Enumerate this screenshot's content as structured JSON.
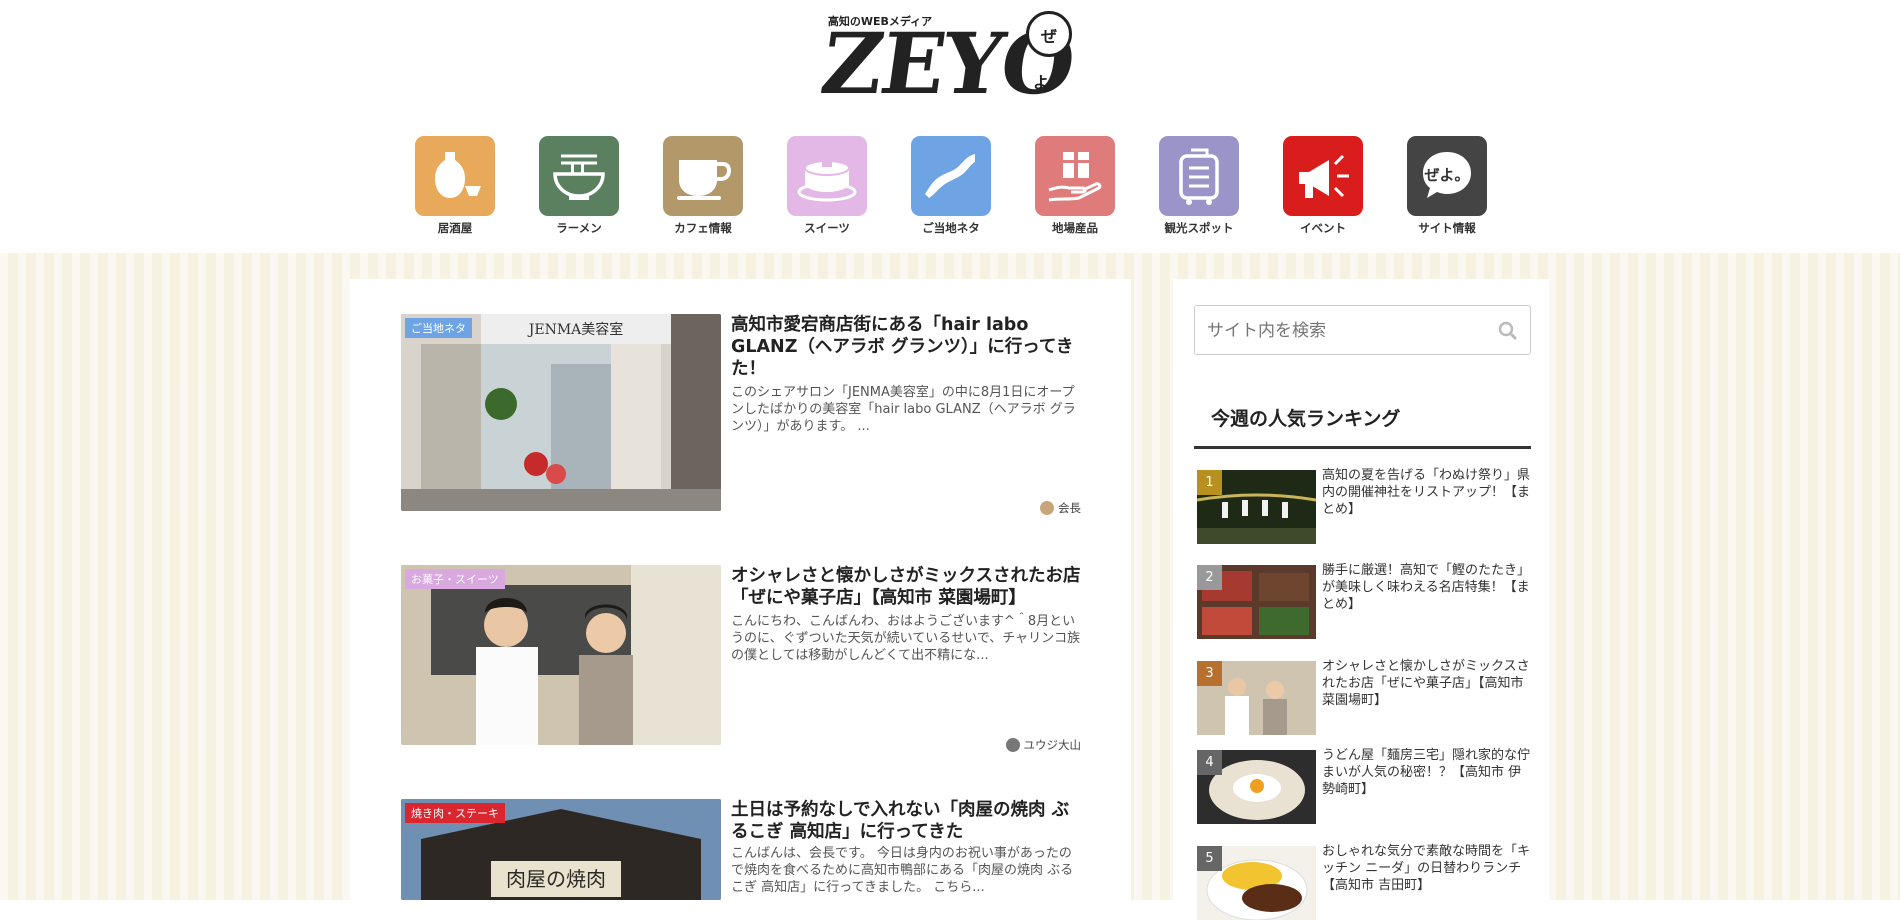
{
  "header": {
    "tagline": "高知のWEBメディア",
    "logo_text": "ZEYO",
    "logo_badge": "ぜよ。"
  },
  "nav": [
    {
      "label": "居酒屋",
      "icon": "sake-bottle-icon",
      "color": "#e8a95a"
    },
    {
      "label": "ラーメン",
      "icon": "ramen-bowl-icon",
      "color": "#5a8060"
    },
    {
      "label": "カフェ情報",
      "icon": "coffee-cup-icon",
      "color": "#b39869"
    },
    {
      "label": "スイーツ",
      "icon": "pancake-icon",
      "color": "#e3b8e6"
    },
    {
      "label": "ご当地ネタ",
      "icon": "kochi-map-icon",
      "color": "#6ea4e3"
    },
    {
      "label": "地場産品",
      "icon": "gift-hand-icon",
      "color": "#e07b7b"
    },
    {
      "label": "観光スポット",
      "icon": "suitcase-icon",
      "color": "#9a94c9"
    },
    {
      "label": "イベント",
      "icon": "megaphone-icon",
      "color": "#d91c1c"
    },
    {
      "label": "サイト情報",
      "icon": "zeyo-speech-icon",
      "color": "#444444"
    }
  ],
  "articles": [
    {
      "category": "ご当地ネタ",
      "category_color": "#6ea4e3",
      "title": "高知市愛宕商店街にある「hair labo GLANZ（ヘアラボ グランツ）」に行ってきた！",
      "excerpt": "このシェアサロン「JENMA美容室」の中に8月1日にオープンしたばかりの美容室「hair labo GLANZ（ヘアラボ グランツ）」があります。 ...",
      "author": "会長",
      "thumb_sign": "JENMA美容室"
    },
    {
      "category": "お菓子・スイーツ",
      "category_color": "#d9a8df",
      "title": "オシャレさと懐かしさがミックスされたお店「ぜにや菓子店」【高知市 菜園場町】",
      "excerpt": "こんにちわ、こんばんわ、おはようございます^＾8月というのに、ぐずついた天気が続いているせいで、チャリンコ族の僕としては移動がしんどくて出不精にな...",
      "author": "ユウジ大山"
    },
    {
      "category": "焼き肉・ステーキ",
      "category_color": "#d9262f",
      "title": "土日は予約なしで入れない「肉屋の焼肉 ぶるこぎ 高知店」に行ってきた",
      "excerpt": "こんばんは、会長です。 今日は身内のお祝い事があったので焼肉を食べるために高知市鴨部にある「肉屋の焼肉 ぶるこぎ 高知店」に行ってきました。 こちら...",
      "author": "",
      "thumb_sign": "肉屋の焼肉"
    }
  ],
  "search": {
    "placeholder": "サイト内を検索"
  },
  "ranking": {
    "title": "今週の人気ランキング",
    "items": [
      {
        "num": "1",
        "badge_color": "#b8901f",
        "title": "高知の夏を告げる「わぬけ祭り」県内の開催神社をリストアップ！【まとめ】"
      },
      {
        "num": "2",
        "badge_color": "#999999",
        "title": "勝手に厳選！高知で「鰹のたたき」が美味しく味わえる名店特集！【まとめ】"
      },
      {
        "num": "3",
        "badge_color": "#b8702f",
        "title": "オシャレさと懐かしさがミックスされたお店「ぜにや菓子店」【高知市 菜園場町】"
      },
      {
        "num": "4",
        "badge_color": "#666666",
        "title": "うどん屋「麺房三宅」隠れ家的な佇まいが人気の秘密！？【高知市 伊勢崎町】"
      },
      {
        "num": "5",
        "badge_color": "#666666",
        "title": "おしゃれな気分で素敵な時間を「キッチン ニーダ」の日替わりランチ【高知市 吉田町】"
      }
    ]
  }
}
